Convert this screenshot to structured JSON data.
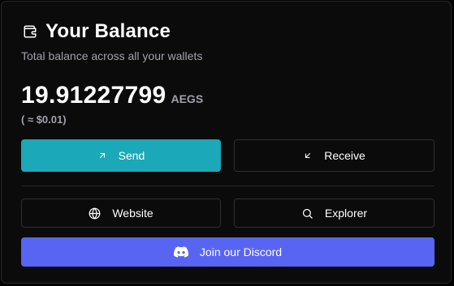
{
  "header": {
    "title": "Your Balance",
    "subtitle": "Total balance across all your wallets",
    "icon": "wallet-icon"
  },
  "balance": {
    "value": "19.91227799",
    "unit": "AEGS",
    "fiat": "( ≈ $0.01)"
  },
  "actions": {
    "send_label": "Send",
    "send_icon": "arrow-up-right-icon",
    "receive_label": "Receive",
    "receive_icon": "arrow-down-left-icon",
    "website_label": "Website",
    "website_icon": "globe-icon",
    "explorer_label": "Explorer",
    "explorer_icon": "search-icon",
    "discord_label": "Join our Discord",
    "discord_icon": "discord-icon"
  },
  "colors": {
    "background": "#0b0b0c",
    "send_button": "#1ba8b8",
    "discord_button": "#5865f2",
    "muted_text": "#a1a1aa",
    "border": "#2f2f33"
  }
}
